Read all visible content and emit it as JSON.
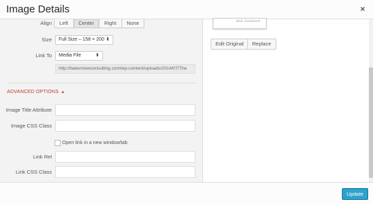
{
  "header": {
    "title": "Image Details",
    "close_glyph": "×",
    "close_icon": "close-icon"
  },
  "form": {
    "align": {
      "label": "Align",
      "options": [
        "Left",
        "Center",
        "Right",
        "None"
      ],
      "selected": "Center"
    },
    "size": {
      "label": "Size",
      "value": "Full Size – 158 × 200"
    },
    "link_to": {
      "label": "Link To",
      "value": "Media File"
    },
    "url": "http://bakerviewconsulting.com/wp-content/uploads/2014/07/The",
    "advanced": {
      "label": "ADVANCED OPTIONS",
      "caret": "▲"
    },
    "image_title_attribute": {
      "label": "Image Title Attribute",
      "value": ""
    },
    "image_css_class": {
      "label": "Image CSS Class",
      "value": ""
    },
    "open_new_window": {
      "label": "Open link in a new window/tab",
      "checked": false
    },
    "link_rel": {
      "label": "Link Rel",
      "value": ""
    },
    "link_css_class": {
      "label": "Link CSS Class",
      "value": ""
    }
  },
  "preview": {
    "signature": "Bob Goldwick"
  },
  "actions": {
    "edit_original": "Edit Original",
    "replace": "Replace"
  },
  "footer": {
    "update": "Update"
  },
  "colors": {
    "accent": "#2ea2cc",
    "advanced": "#c0392b"
  }
}
